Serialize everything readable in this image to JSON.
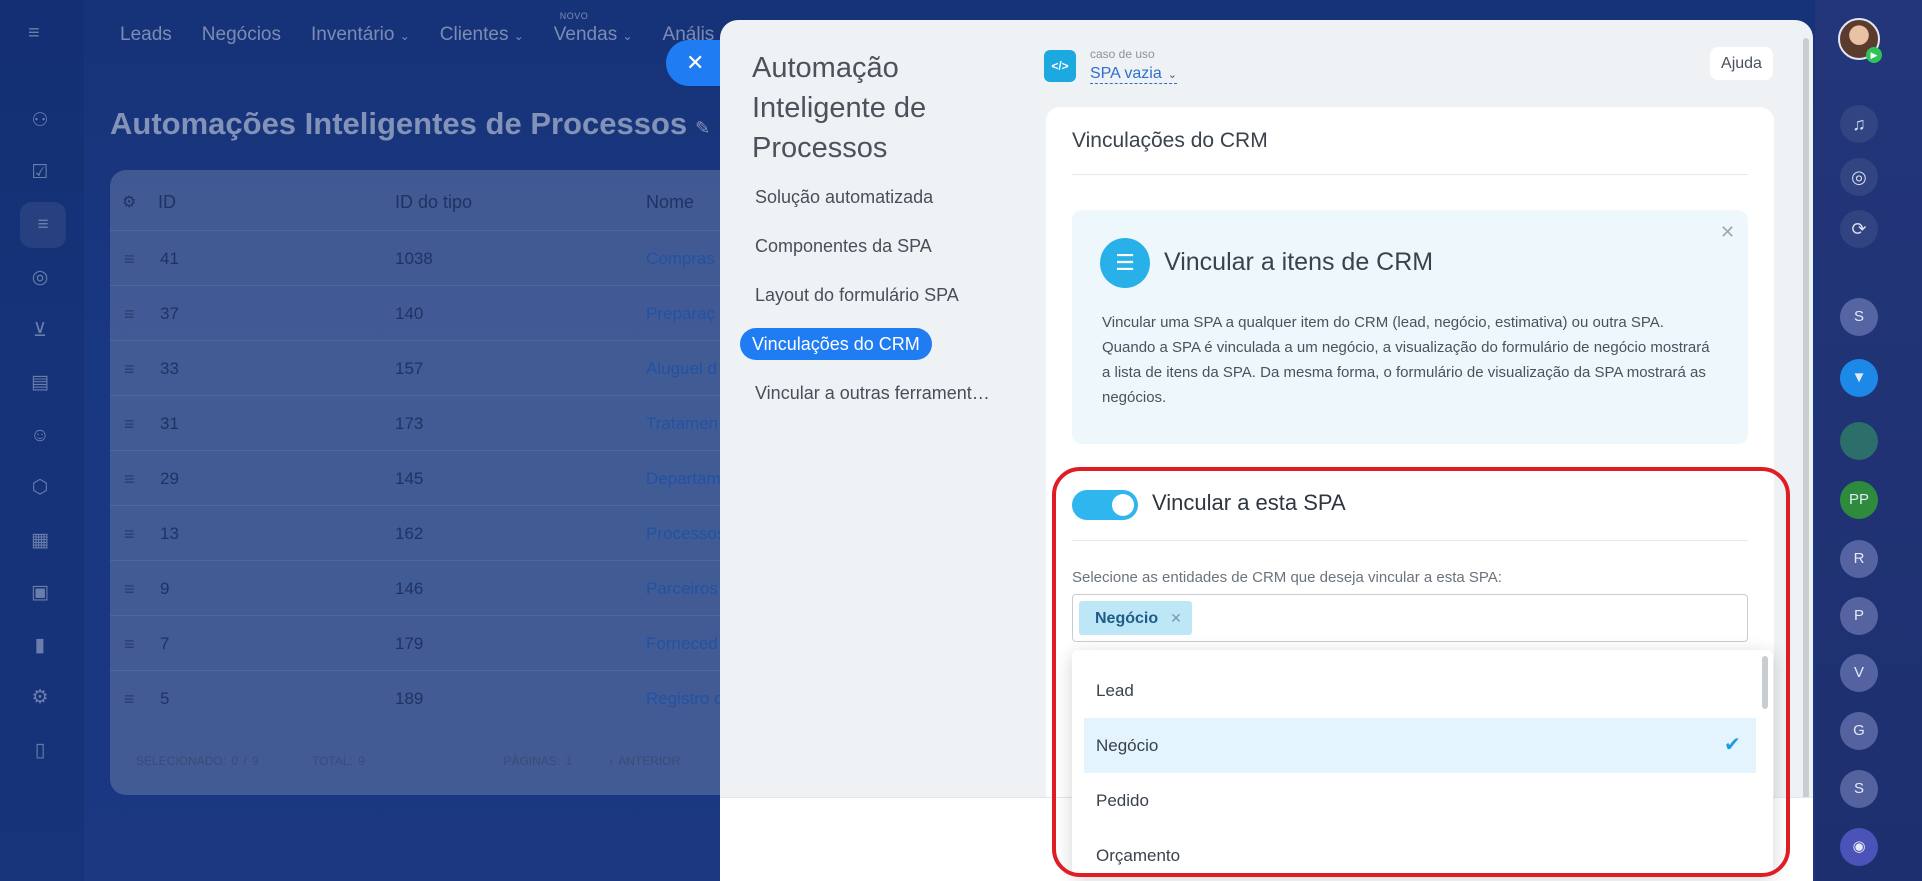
{
  "background": {
    "top_nav": [
      {
        "label": "Leads",
        "chevron": false,
        "new_tag": ""
      },
      {
        "label": "Negócios",
        "chevron": false,
        "new_tag": ""
      },
      {
        "label": "Inventário",
        "chevron": true,
        "new_tag": ""
      },
      {
        "label": "Clientes",
        "chevron": true,
        "new_tag": ""
      },
      {
        "label": "Vendas",
        "chevron": true,
        "new_tag": "NOVO"
      },
      {
        "label": "Anális",
        "chevron": false,
        "new_tag": ""
      }
    ],
    "page_title": "Automações Inteligentes de Processos",
    "grid": {
      "columns": [
        "ID",
        "ID do tipo",
        "Nome"
      ],
      "rows": [
        {
          "id": "41",
          "type_id": "1038",
          "name": "Compras"
        },
        {
          "id": "37",
          "type_id": "140",
          "name": "Preparaç"
        },
        {
          "id": "33",
          "type_id": "157",
          "name": "Aluguel d"
        },
        {
          "id": "31",
          "type_id": "173",
          "name": "Tratamen"
        },
        {
          "id": "29",
          "type_id": "145",
          "name": "Departam"
        },
        {
          "id": "13",
          "type_id": "162",
          "name": "Processos"
        },
        {
          "id": "9",
          "type_id": "146",
          "name": "Parceiros"
        },
        {
          "id": "7",
          "type_id": "179",
          "name": "Forneced"
        },
        {
          "id": "5",
          "type_id": "189",
          "name": "Registro d"
        }
      ],
      "footer": {
        "selected": "SELECIONADO: 0 / 9",
        "total": "TOTAL: 9",
        "pages": "PÁGINAS: 1",
        "prev": "‹ ANTERIOR"
      }
    }
  },
  "right_rail": {
    "avatars": [
      {
        "initial": "S",
        "color": "#8a83c9"
      },
      {
        "initial": "",
        "color": "#1c89e8"
      },
      {
        "initial": "",
        "color": "#2b6e6a"
      },
      {
        "initial": "PP",
        "color": "#2e8b3d"
      },
      {
        "initial": "R",
        "color": "#5b61c0"
      },
      {
        "initial": "P",
        "color": "#6a5dc9"
      },
      {
        "initial": "V",
        "color": "#6a5dc9"
      },
      {
        "initial": "G",
        "color": "#5b61c0"
      },
      {
        "initial": "S",
        "color": "#5b61c0"
      },
      {
        "initial": "",
        "color": "#4b52b8"
      }
    ]
  },
  "slider": {
    "title": "Automação Inteligente de Processos",
    "nav": [
      {
        "label": "Solução automatizada",
        "active": false
      },
      {
        "label": "Componentes da SPA",
        "active": false
      },
      {
        "label": "Layout do formulário SPA",
        "active": false
      },
      {
        "label": "Vinculações do CRM",
        "active": true
      },
      {
        "label": "Vincular a outras ferramentas",
        "active": false
      }
    ],
    "use_case": {
      "label": "caso de uso",
      "value": "SPA vazia"
    },
    "help_label": "Ajuda",
    "section_title": "Vinculações do CRM",
    "info": {
      "title": "Vincular a itens de CRM",
      "text": "Vincular uma SPA a qualquer item do CRM (lead, negócio, estimativa) ou outra SPA. Quando a SPA é vinculada a um negócio, a visualização do formulário de negócio mostrará a lista de itens da SPA. Da mesma forma, o formulário de visualização da SPA mostrará as negócios."
    },
    "toggle": {
      "label": "Vincular a esta SPA",
      "on": true
    },
    "entities_label": "Selecione as entidades de CRM que deseja vincular a esta SPA:",
    "selected_tags": [
      "Negócio"
    ],
    "dropdown": [
      {
        "label": "Lead",
        "selected": false
      },
      {
        "label": "Negócio",
        "selected": true
      },
      {
        "label": "Pedido",
        "selected": false
      },
      {
        "label": "Orçamento",
        "selected": false
      }
    ]
  },
  "colors": {
    "accent": "#1f7cf2",
    "toggle_on": "#2fb6ee",
    "highlight": "#e11d24",
    "selected_row": "#e3f4fc"
  }
}
